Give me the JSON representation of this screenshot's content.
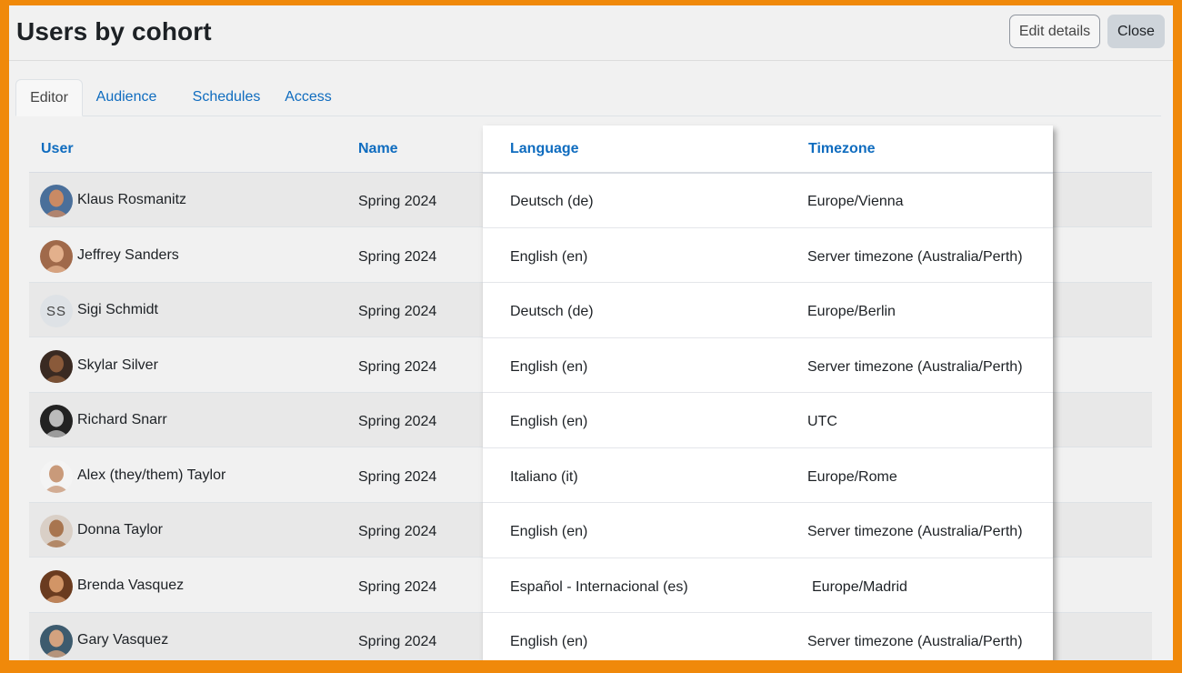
{
  "page": {
    "title": "Users by cohort",
    "buttons": {
      "edit_details": "Edit details",
      "close": "Close"
    }
  },
  "tabs": [
    {
      "label": "Editor",
      "active": true
    },
    {
      "label": "Audience",
      "active": false
    },
    {
      "label": "Schedules",
      "active": false
    },
    {
      "label": "Access",
      "active": false
    }
  ],
  "table": {
    "columns": [
      "User",
      "Name",
      "Language",
      "Timezone"
    ],
    "rows": [
      {
        "user": "Klaus Rosmanitz",
        "avatar": "photo",
        "name": "Spring 2024",
        "language": "Deutsch (de)",
        "timezone": "Europe/Vienna"
      },
      {
        "user": "Jeffrey Sanders",
        "avatar": "photo",
        "name": "Spring 2024",
        "language": "English (en)",
        "timezone": "Server timezone (Australia/Perth)"
      },
      {
        "user": "Sigi Schmidt",
        "avatar": "initials",
        "initials": "SS",
        "name": "Spring 2024",
        "language": "Deutsch (de)",
        "timezone": "Europe/Berlin"
      },
      {
        "user": "Skylar Silver",
        "avatar": "photo",
        "name": "Spring 2024",
        "language": "English (en)",
        "timezone": "Server timezone (Australia/Perth)"
      },
      {
        "user": "Richard Snarr",
        "avatar": "photo",
        "name": "Spring 2024",
        "language": "English (en)",
        "timezone": "UTC"
      },
      {
        "user": "Alex (they/them) Taylor",
        "avatar": "photo",
        "name": "Spring 2024",
        "language": "Italiano (it)",
        "timezone": "Europe/Rome"
      },
      {
        "user": "Donna Taylor",
        "avatar": "photo",
        "name": "Spring 2024",
        "language": "English (en)",
        "timezone": "Server timezone (Australia/Perth)"
      },
      {
        "user": "Brenda Vasquez",
        "avatar": "photo",
        "name": "Spring 2024",
        "language": "Español - Internacional (es)",
        "timezone": "Europe/Madrid"
      },
      {
        "user": "Gary Vasquez",
        "avatar": "photo",
        "name": "Spring 2024",
        "language": "English (en)",
        "timezone": "Server timezone (Australia/Perth)"
      }
    ]
  },
  "colors": {
    "frame_border": "#f0890a",
    "link_blue": "#0f6cbf",
    "highlight_panel": "#ffffff"
  }
}
